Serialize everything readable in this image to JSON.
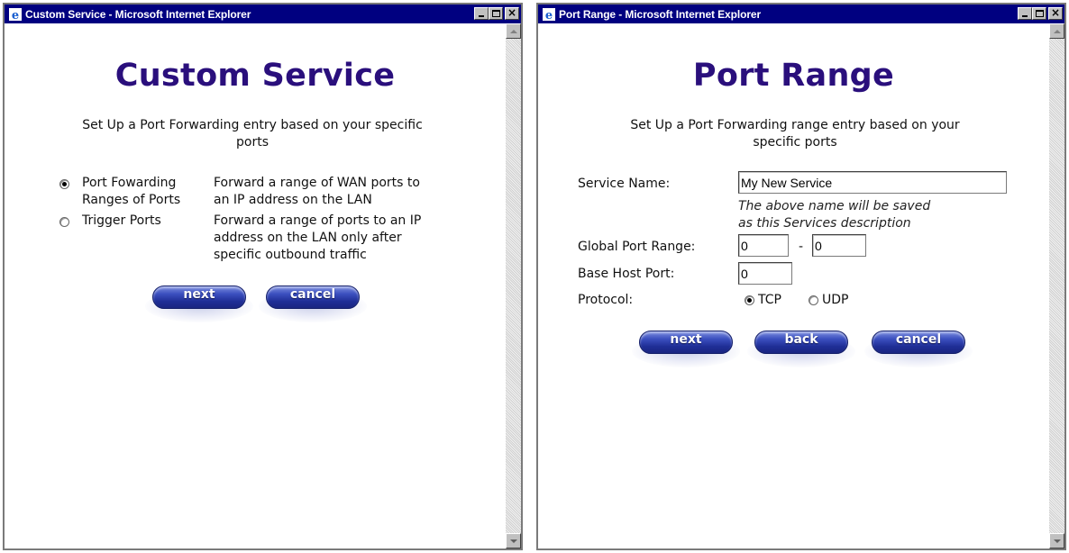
{
  "left_window": {
    "title": "Custom Service - Microsoft Internet Explorer",
    "heading": "Custom Service",
    "intro_line1": "Set Up a Port Forwarding entry based on your specific",
    "intro_line2": "ports",
    "options": [
      {
        "label_line1": "Port Fowarding",
        "label_line2": "Ranges of Ports",
        "desc_line1": "Forward a range of WAN ports to",
        "desc_line2": "an IP address on the LAN",
        "desc_line3": "",
        "selected": true
      },
      {
        "label_line1": "Trigger Ports",
        "label_line2": "",
        "desc_line1": "Forward a range of ports to an IP",
        "desc_line2": "address on the LAN only after",
        "desc_line3": "specific outbound traffic",
        "selected": false
      }
    ],
    "buttons": {
      "next": "next",
      "cancel": "cancel"
    }
  },
  "right_window": {
    "title": "Port Range - Microsoft Internet Explorer",
    "heading": "Port Range",
    "intro_line1": "Set Up a Port Forwarding range entry based on your",
    "intro_line2": "specific ports",
    "service_name_label": "Service Name:",
    "service_name_value": "My New Service",
    "note_line1": "The above name will be saved",
    "note_line2": "as this Services description",
    "global_port_range_label": "Global Port Range:",
    "global_port_start": "0",
    "range_separator": "-",
    "global_port_end": "0",
    "base_host_port_label": "Base Host Port:",
    "base_host_port_value": "0",
    "protocol_label": "Protocol:",
    "protocol_options": [
      {
        "label": "TCP",
        "selected": true
      },
      {
        "label": "UDP",
        "selected": false
      }
    ],
    "buttons": {
      "next": "next",
      "back": "back",
      "cancel": "cancel"
    }
  },
  "colors": {
    "title_bar": "#000080",
    "heading": "#2a0f7c",
    "button": "#2b3ca8"
  }
}
